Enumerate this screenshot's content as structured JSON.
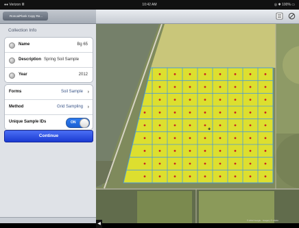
{
  "status": {
    "carrier": "●● Verizon ≣",
    "time": "10:42 AM",
    "battery": "◎ ✱ 100% ▭"
  },
  "nav": {
    "back_label": "Ronca/Plank Copy Re..."
  },
  "collection_info": {
    "title": "Collection Info",
    "name_label": "Name",
    "name_value": "Bg 65",
    "description_label": "Description",
    "description_value": "Spring Soil Sample",
    "year_label": "Year",
    "year_value": "2012"
  },
  "options": {
    "forms_label": "Forms",
    "forms_value": "Soil Sample",
    "method_label": "Method",
    "method_value": "Grid Sampling",
    "unique_label": "Unique Sample IDs",
    "unique_toggle": "ON"
  },
  "continue_label": "Continue",
  "map": {
    "grid_fill_color": "#f2f226",
    "grid_line_color": "#4a9ad8",
    "point_color": "#cc2222",
    "credit": "© 2012 Google · Imagery © USDA"
  },
  "icons": {
    "toolbar_left": "list-icon",
    "toolbar_right": "no-entry-icon",
    "collapse": "triangle-left-icon"
  }
}
